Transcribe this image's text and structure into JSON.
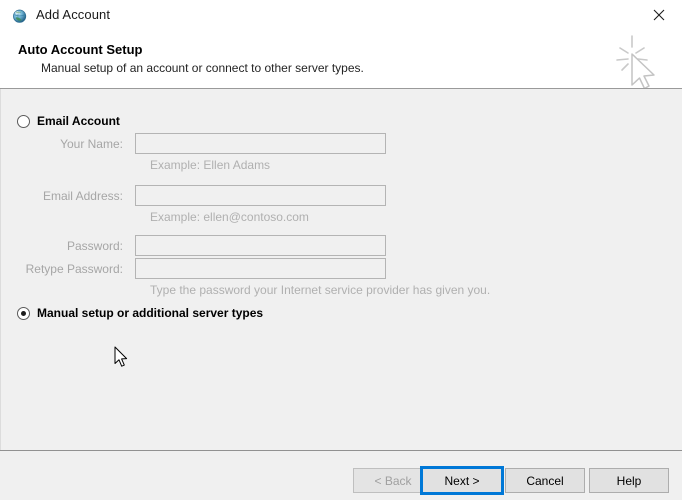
{
  "window": {
    "title": "Add Account",
    "title_icon": "globe-icon",
    "close_icon": "close-icon"
  },
  "header": {
    "title": "Auto Account Setup",
    "subtitle": "Manual setup of an account or connect to other server types.",
    "art_icon": "cursor-sparkle-icon"
  },
  "options": {
    "email_account": {
      "label": "Email Account",
      "selected": false
    },
    "manual_setup": {
      "label": "Manual setup or additional server types",
      "selected": true
    }
  },
  "form": {
    "your_name": {
      "label": "Your Name:",
      "value": "",
      "placeholder": "",
      "hint": "Example: Ellen Adams"
    },
    "email_address": {
      "label": "Email Address:",
      "value": "",
      "placeholder": "",
      "hint": "Example: ellen@contoso.com"
    },
    "password": {
      "label": "Password:",
      "value": "",
      "placeholder": ""
    },
    "retype_password": {
      "label": "Retype Password:",
      "value": "",
      "placeholder": "",
      "hint": "Type the password your Internet service provider has given you."
    }
  },
  "footer": {
    "back": "< Back",
    "next": "Next >",
    "cancel": "Cancel",
    "help": "Help"
  },
  "colors": {
    "accent": "#0078d7",
    "dialog_bg": "#f0f0f0",
    "header_bg": "#ffffff",
    "disabled_text": "#a0a0a0",
    "label_gray": "#a6a6a6",
    "hint_gray": "#b0b0b0"
  }
}
